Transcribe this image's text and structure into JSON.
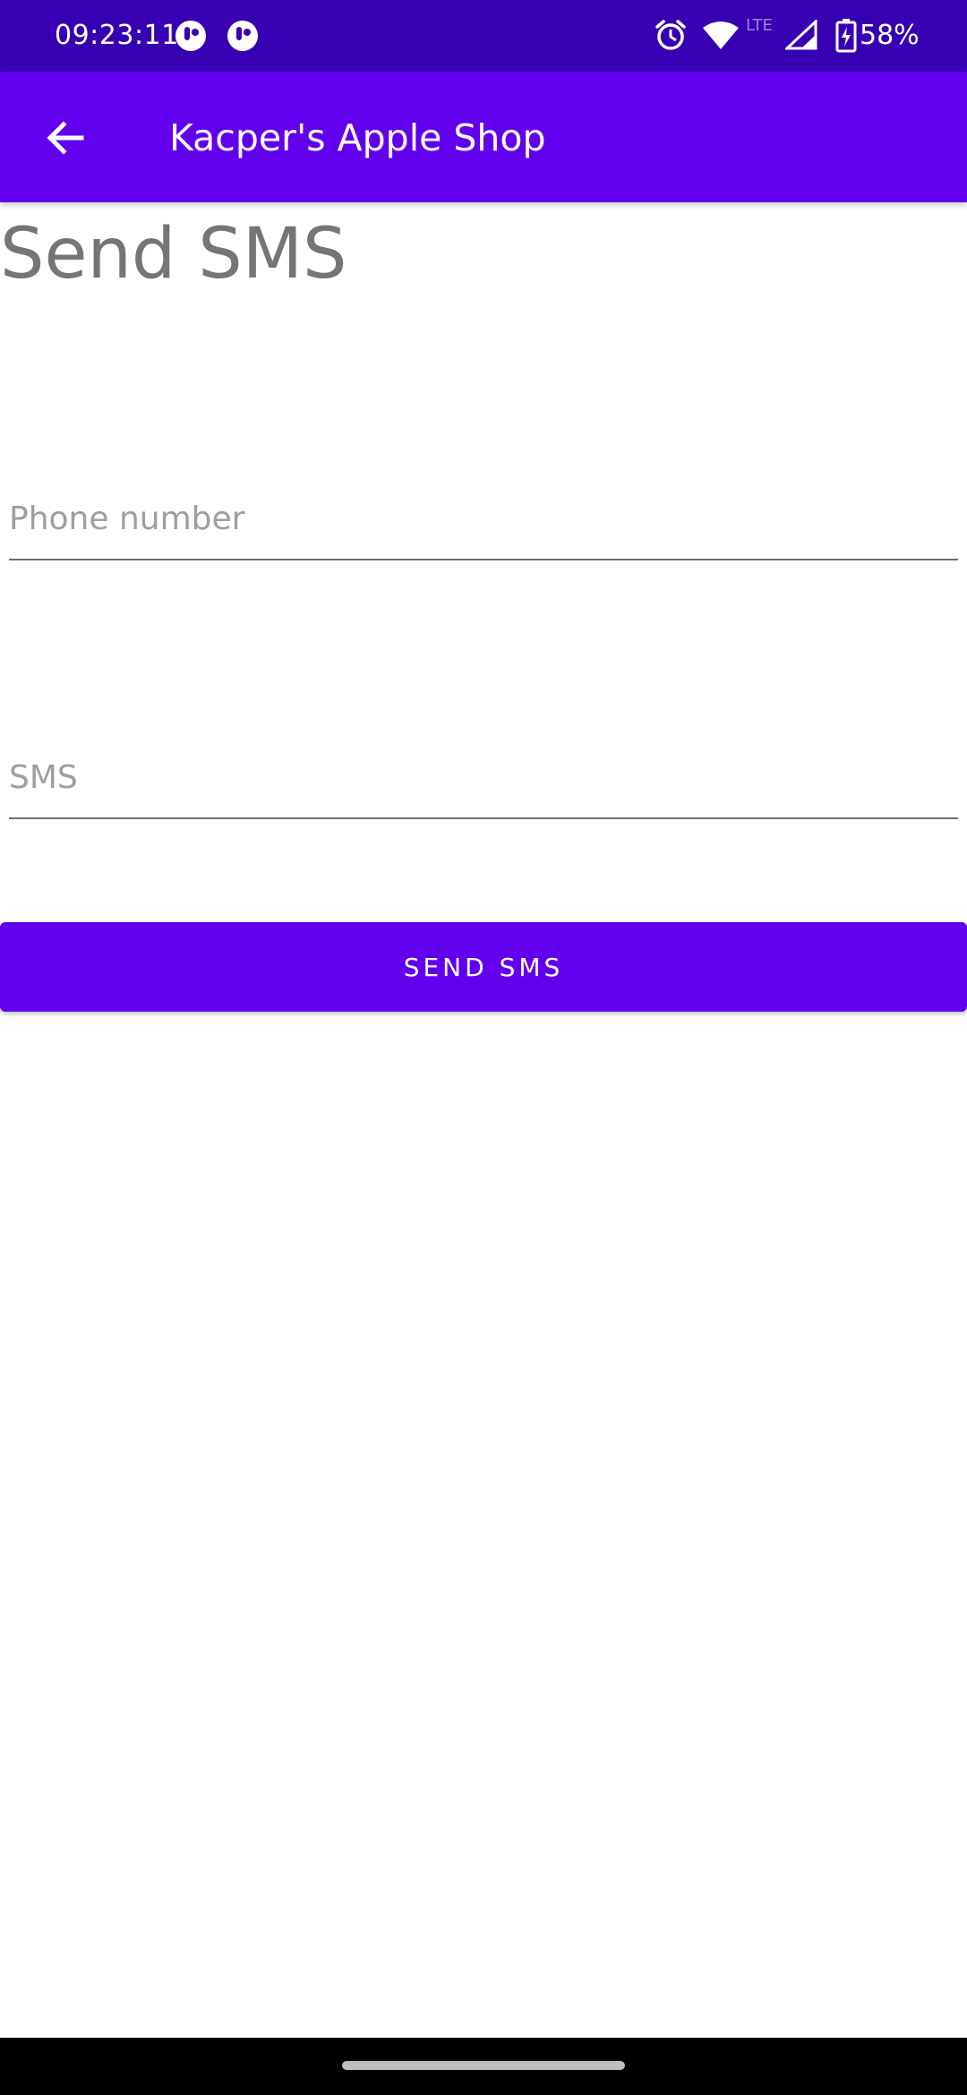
{
  "status_bar": {
    "time": "09:23:11",
    "network": "LTE",
    "battery": "58%",
    "icons": [
      "app-notification-icon",
      "app-notification-icon",
      "alarm-icon",
      "wifi-icon",
      "signal-icon",
      "battery-charging-icon"
    ]
  },
  "app_bar": {
    "back_icon": "arrow-back-icon",
    "title": "Kacper's Apple Shop"
  },
  "main": {
    "title": "Send SMS",
    "phone_field": {
      "placeholder": "Phone number",
      "value": ""
    },
    "sms_field": {
      "placeholder": "SMS",
      "value": ""
    },
    "send_button_label": "SEND SMS"
  },
  "colors": {
    "status_bar": "#3700b3",
    "primary": "#6200ee",
    "title_text": "#757575",
    "hint_text": "#9e9e9e"
  }
}
